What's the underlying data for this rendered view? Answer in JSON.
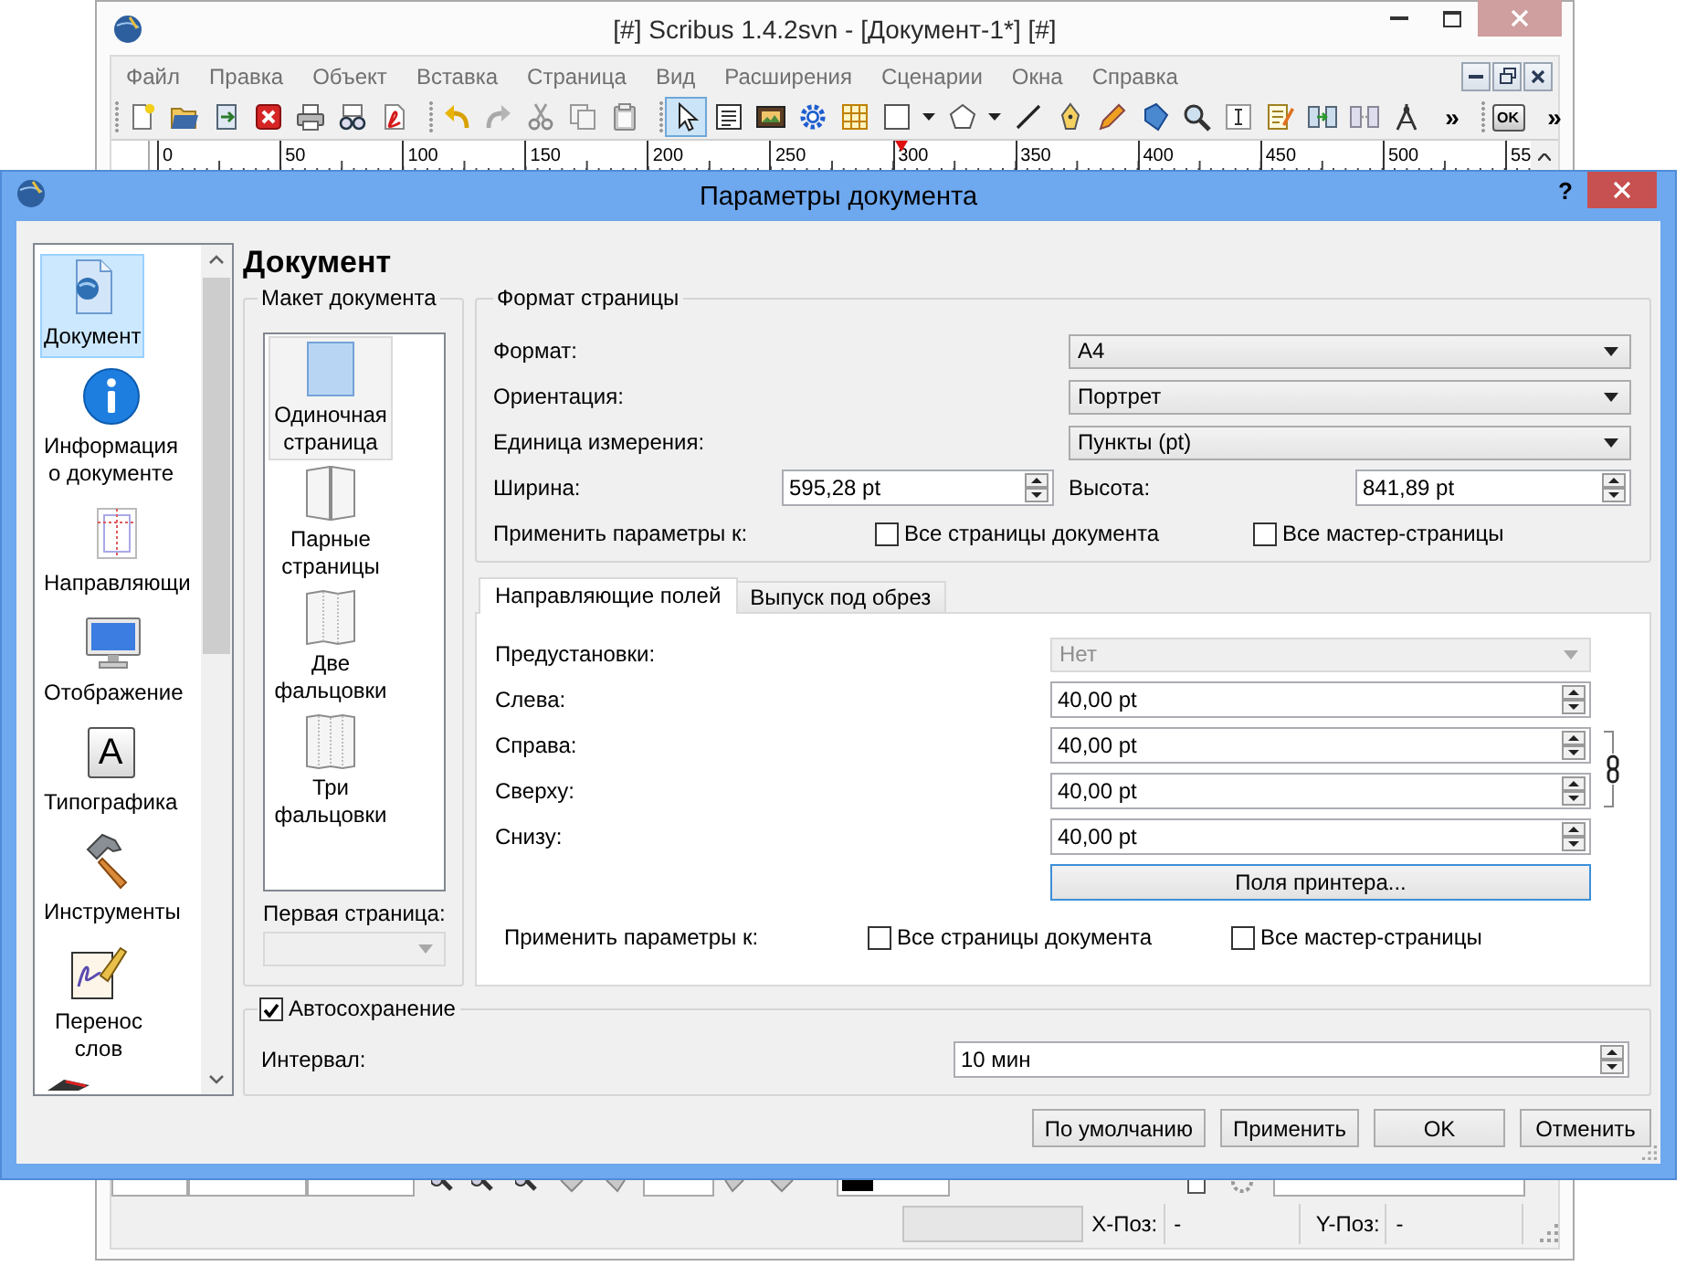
{
  "main_window": {
    "title": "[#] Scribus 1.4.2svn - [Документ-1*] [#]",
    "menu": [
      "Файл",
      "Правка",
      "Объект",
      "Вставка",
      "Страница",
      "Вид",
      "Расширения",
      "Сценарии",
      "Окна",
      "Справка"
    ],
    "toolbars": [
      {
        "tools": [
          {
            "kind": "new"
          },
          {
            "kind": "open"
          },
          {
            "kind": "revert"
          },
          {
            "kind": "close"
          },
          {
            "kind": "print"
          },
          {
            "kind": "preflight"
          },
          {
            "kind": "pdf"
          }
        ]
      },
      {
        "tools": [
          {
            "kind": "undo"
          },
          {
            "kind": "redo"
          },
          {
            "kind": "cut"
          },
          {
            "kind": "copy"
          },
          {
            "kind": "paste"
          }
        ]
      },
      {
        "tools": [
          {
            "kind": "select",
            "selected": true
          },
          {
            "kind": "text_frame",
            "selected": false
          },
          {
            "kind": "image_frame",
            "selected": false
          },
          {
            "kind": "render_frame",
            "selected": false
          },
          {
            "kind": "table",
            "selected": false
          },
          {
            "kind": "shape",
            "selected": false
          },
          {
            "kind": "polygon",
            "selected": false
          },
          {
            "kind": "line",
            "selected": false
          },
          {
            "kind": "bezier",
            "selected": false
          },
          {
            "kind": "freehand",
            "selected": false
          },
          {
            "kind": "rotate",
            "selected": false
          },
          {
            "kind": "zoom",
            "selected": false
          },
          {
            "kind": "edit_text",
            "selected": false
          },
          {
            "kind": "story_editor",
            "selected": false
          },
          {
            "kind": "link",
            "selected": false
          },
          {
            "kind": "unlink",
            "selected": false
          },
          {
            "kind": "measure",
            "selected": false
          }
        ],
        "overflow": "»"
      },
      {
        "tools": [
          {
            "kind": "verifier",
            "label": "OK"
          }
        ],
        "overflow": "»"
      }
    ],
    "ruler": {
      "labels": [
        "0",
        "50",
        "100",
        "150",
        "200",
        "250",
        "300",
        "350",
        "400",
        "450",
        "500",
        "55"
      ]
    },
    "status_bar": {
      "x_label": "X-Поз:",
      "x_value": "-",
      "y_label": "Y-Поз:",
      "y_value": "-"
    }
  },
  "dialog": {
    "title": "Параметры документа",
    "help": "?",
    "sidebar": {
      "items": [
        {
          "kind": "document",
          "label": "Документ",
          "selected": true
        },
        {
          "kind": "info",
          "label": "Информация о документе",
          "selected": false
        },
        {
          "kind": "guides",
          "label": "Направляющи",
          "selected": false
        },
        {
          "kind": "display",
          "label": "Отображение",
          "selected": false
        },
        {
          "kind": "typography",
          "glyph": "A",
          "label": "Типографика",
          "selected": false
        },
        {
          "kind": "tools",
          "label": "Инструменты",
          "selected": false
        },
        {
          "kind": "hyphenator",
          "label": "Перенос слов",
          "selected": false
        },
        {
          "kind": "stamp",
          "selected": false
        }
      ]
    },
    "heading": "Документ",
    "layout": {
      "title": "Макет документа",
      "items": [
        {
          "kind": "single",
          "label": "Одиночная страница",
          "selected": true
        },
        {
          "kind": "facing",
          "label": "Парные страницы",
          "selected": false
        },
        {
          "kind": "fold3",
          "label": "Две фальцовки",
          "selected": false
        },
        {
          "kind": "fold4",
          "label": "Три фальцовки",
          "selected": false
        }
      ],
      "first_page": {
        "label": "Первая страница:",
        "disabled": true
      }
    },
    "page_format": {
      "title": "Формат страницы",
      "dropdowns": [
        {
          "label": "Формат:",
          "value": "A4"
        },
        {
          "label": "Ориентация:",
          "value": "Портрет"
        },
        {
          "label": "Единица измерения:",
          "value": "Пункты (pt)"
        }
      ],
      "width": {
        "label": "Ширина:",
        "value": "595,28 pt"
      },
      "height": {
        "label": "Высота:",
        "value": "841,89 pt"
      },
      "apply": {
        "label": "Применить параметры к:",
        "options": [
          {
            "label": "Все страницы документа",
            "checked": false
          },
          {
            "label": "Все мастер-страницы",
            "checked": false
          }
        ]
      }
    },
    "tabs": [
      {
        "label": "Направляющие полей",
        "selected": true
      },
      {
        "label": "Выпуск под обрез",
        "selected": false
      }
    ],
    "margins": {
      "preset": {
        "label": "Предустановки:",
        "value": "Нет",
        "disabled": true
      },
      "fields": [
        {
          "label": "Слева:",
          "value": "40,00 pt"
        },
        {
          "label": "Справа:",
          "value": "40,00 pt"
        },
        {
          "label": "Сверху:",
          "value": "40,00 pt"
        },
        {
          "label": "Снизу:",
          "value": "40,00 pt"
        }
      ],
      "printer_button": {
        "label": "Поля принтера...",
        "focused": true
      },
      "apply": {
        "label": "Применить параметры к:",
        "options": [
          {
            "label": "Все страницы документа",
            "checked": false
          },
          {
            "label": "Все мастер-страницы",
            "checked": false
          }
        ]
      }
    },
    "autosave": {
      "label": "Автосохранение",
      "checked": true,
      "interval_label": "Интервал:",
      "interval": "10 мин"
    },
    "buttons": [
      "По умолчанию",
      "Применить",
      "OK",
      "Отменить"
    ]
  }
}
